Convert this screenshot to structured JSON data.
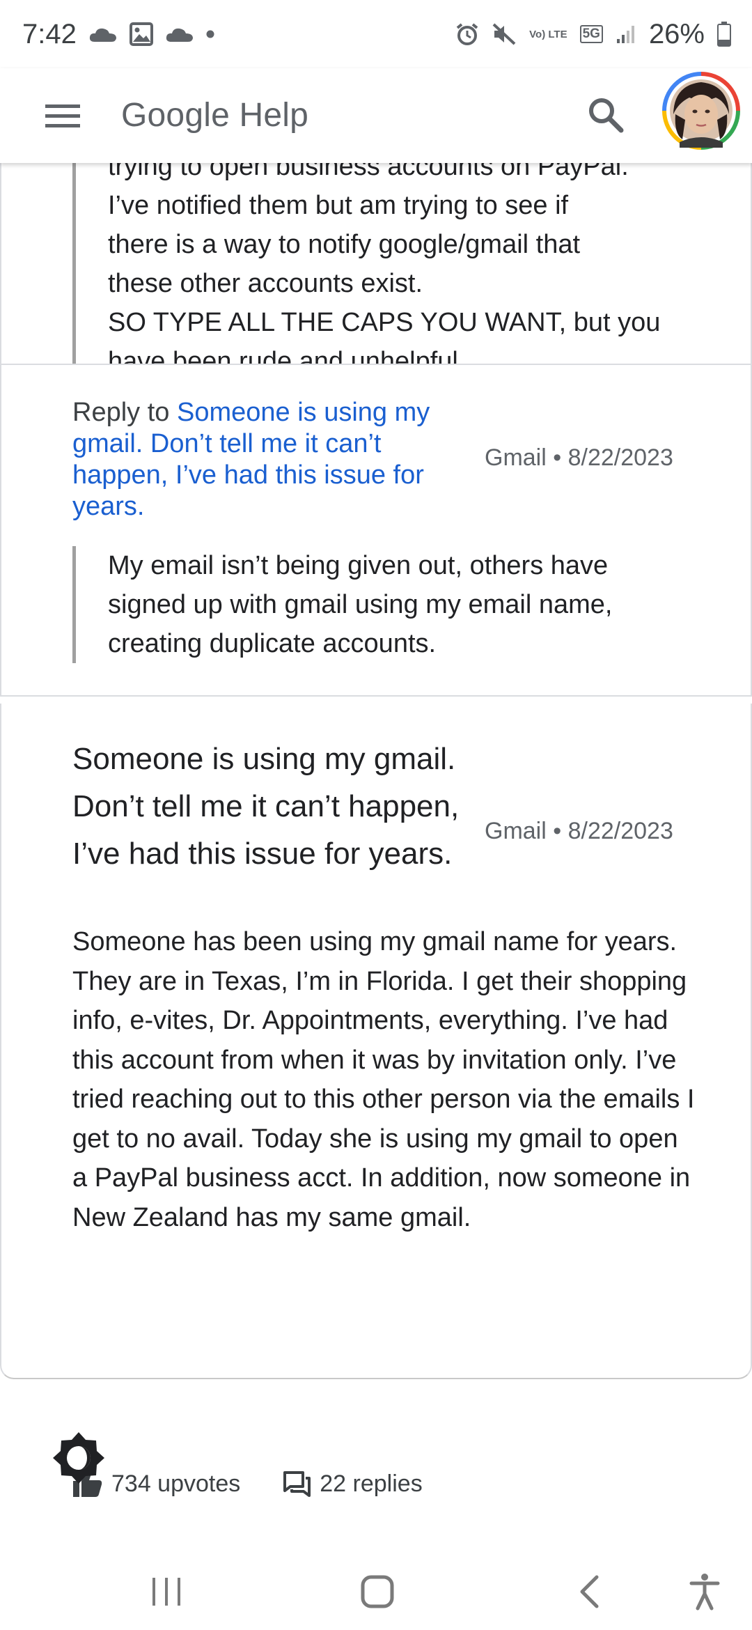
{
  "status_bar": {
    "time": "7:42",
    "battery_percent": "26%",
    "network": "5G",
    "volte": "Vo) LTE",
    "icons": [
      "onedrive-icon",
      "gallery-icon",
      "cloud-icon",
      "dot-icon",
      "alarm-icon",
      "mute-icon",
      "volte-icon",
      "5g-icon",
      "signal-icon",
      "battery-icon"
    ]
  },
  "app_bar": {
    "title": "Google Help",
    "icons": [
      "menu-icon",
      "search-icon",
      "avatar"
    ]
  },
  "thread": {
    "quoted_fragment": {
      "lines": [
        "trying to open business accounts on PayPal.",
        "I’ve notified them but am trying to see if",
        "there is a way to notify google/gmail that",
        "these other accounts exist.",
        "SO TYPE ALL THE CAPS YOU WANT, but you",
        "have been rude and unhelpful"
      ]
    },
    "reply": {
      "prefix": "Reply to",
      "link_text": "Someone is using my gmail. Don’t tell me it can’t happen, I’ve had this issue for years.",
      "product": "Gmail",
      "separator": "•",
      "date": "8/22/2023",
      "quote_lines": [
        "My email isn’t being given out, others have",
        "signed up with gmail using my email name,",
        "creating duplicate accounts."
      ]
    },
    "post": {
      "title": "Someone is using my gmail. Don’t tell me it can’t happen, I’ve had this issue for years.",
      "product": "Gmail",
      "separator": "•",
      "date": "8/22/2023",
      "body": "Someone has been using my gmail name for years. They are in Texas, I’m in Florida. I get their shopping info, e-vites, Dr. Appointments, everything. I’ve had this account from when it was by invitation only. I’ve tried reaching out to this other person via the emails I get to no avail. Today she is using my gmail to open a PayPal business acct. In addition, now someone in New Zealand has my same gmail.",
      "upvotes": "734 upvotes",
      "replies": "22 replies"
    }
  },
  "theme_toggle": {
    "icon": "brightness-icon"
  },
  "nav_bar": {
    "icons": [
      "recents-icon",
      "home-icon",
      "back-icon",
      "accessibility-icon"
    ]
  },
  "colors": {
    "link": "#1a5fd0",
    "text": "#202124",
    "muted": "#5f6368",
    "divider": "#dadce0",
    "quote_bar": "#a0a0a0"
  }
}
